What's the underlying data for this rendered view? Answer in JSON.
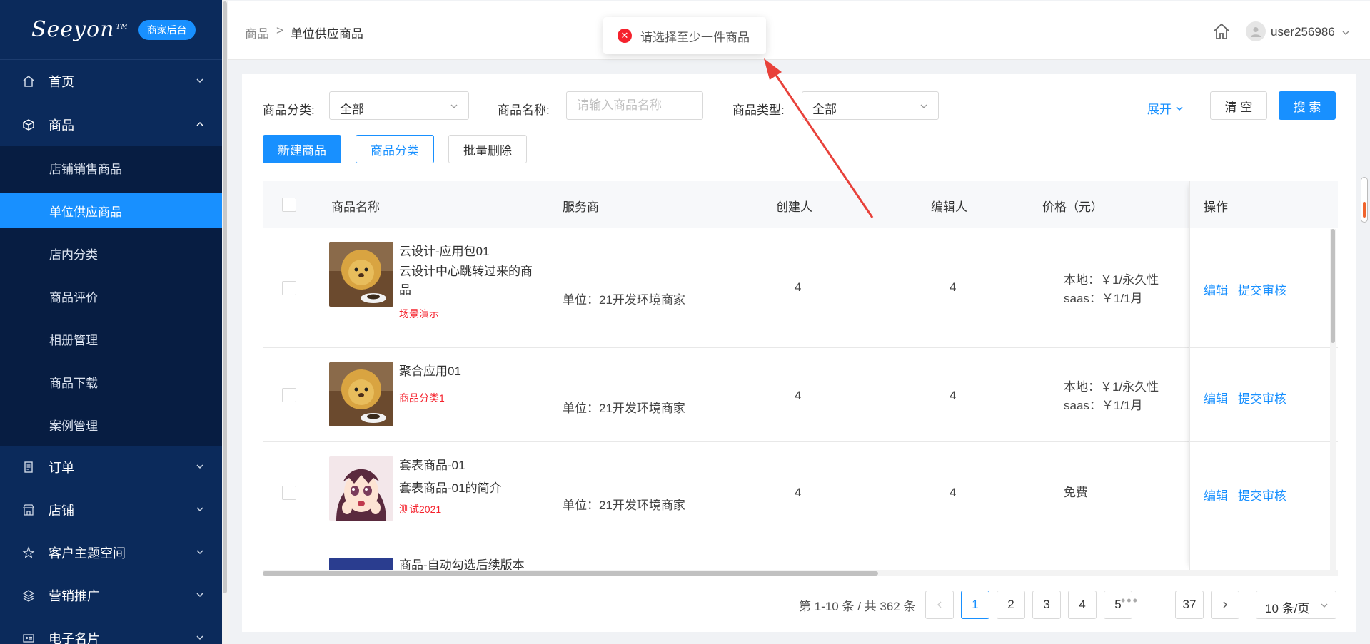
{
  "brand": {
    "logo_text": "Seeyon",
    "tm": "TM",
    "badge": "商家后台"
  },
  "sidebar": {
    "groups": [
      {
        "label": "首页",
        "icon": "home-icon"
      },
      {
        "label": "商品",
        "icon": "cube-icon"
      },
      {
        "label": "订单",
        "icon": "order-icon"
      },
      {
        "label": "店铺",
        "icon": "store-icon"
      },
      {
        "label": "客户主题空间",
        "icon": "star-icon"
      },
      {
        "label": "营销推广",
        "icon": "layers-icon"
      },
      {
        "label": "电子名片",
        "icon": "card-icon"
      }
    ],
    "sub_items": [
      {
        "label": "店铺销售商品"
      },
      {
        "label": "单位供应商品"
      },
      {
        "label": "店内分类"
      },
      {
        "label": "商品评价"
      },
      {
        "label": "相册管理"
      },
      {
        "label": "商品下载"
      },
      {
        "label": "案例管理"
      }
    ]
  },
  "header": {
    "breadcrumb_parent": "商品",
    "breadcrumb_sep": ">",
    "breadcrumb_current": "单位供应商品",
    "username": "user256986"
  },
  "toast": {
    "message": "请选择至少一件商品",
    "type": "error",
    "icon": "error-circle-icon"
  },
  "filters": {
    "category_label": "商品分类:",
    "category_value": "全部",
    "name_label": "商品名称:",
    "name_placeholder": "请输入商品名称",
    "type_label": "商品类型:",
    "type_value": "全部",
    "expand_label": "展开",
    "clear_label": "清 空",
    "search_label": "搜 索"
  },
  "actions": {
    "new_label": "新建商品",
    "category_label": "商品分类",
    "batch_delete_label": "批量删除"
  },
  "table": {
    "columns": [
      "商品名称",
      "服务商",
      "创建人",
      "编辑人",
      "价格（元）",
      "操作"
    ],
    "rows": [
      {
        "name": "云设计-应用包01",
        "desc": "云设计中心跳转过来的商品",
        "tag": "场景演示",
        "provider": "单位：21开发环境商家",
        "creator": "4",
        "editor": "4",
        "price_line1": "本地：￥1/永久性",
        "price_line2": "saas：￥1/1月",
        "op_edit": "编辑",
        "op_submit": "提交审核"
      },
      {
        "name": "聚合应用01",
        "desc": "",
        "tag": "商品分类1",
        "provider": "单位：21开发环境商家",
        "creator": "4",
        "editor": "4",
        "price_line1": "本地：￥1/永久性",
        "price_line2": "saas：￥1/1月",
        "op_edit": "编辑",
        "op_submit": "提交审核"
      },
      {
        "name": "套表商品-01",
        "desc": "套表商品-01的简介",
        "tag": "测试2021",
        "provider": "单位：21开发环境商家",
        "creator": "4",
        "editor": "4",
        "price_line1": "免费",
        "price_line2": "",
        "op_edit": "编辑",
        "op_submit": "提交审核"
      },
      {
        "name": "商品-自动勾选后续版本",
        "desc": "",
        "tag": "",
        "provider": "",
        "creator": "",
        "editor": "",
        "price_line1": "",
        "price_line2": "",
        "op_edit": "",
        "op_submit": ""
      }
    ]
  },
  "pagination": {
    "total_text": "第 1-10 条 / 共 362 条",
    "pages": [
      "1",
      "2",
      "3",
      "4",
      "5"
    ],
    "last_page": "37",
    "ellipsis": "•••",
    "current": "1",
    "page_size": "10 条/页"
  },
  "colors": {
    "sidebar": "#0b2a5b",
    "submenu": "#071d42",
    "accent": "#1890ff",
    "error": "#f5222d",
    "annotation_arrow": "#e8413a"
  }
}
